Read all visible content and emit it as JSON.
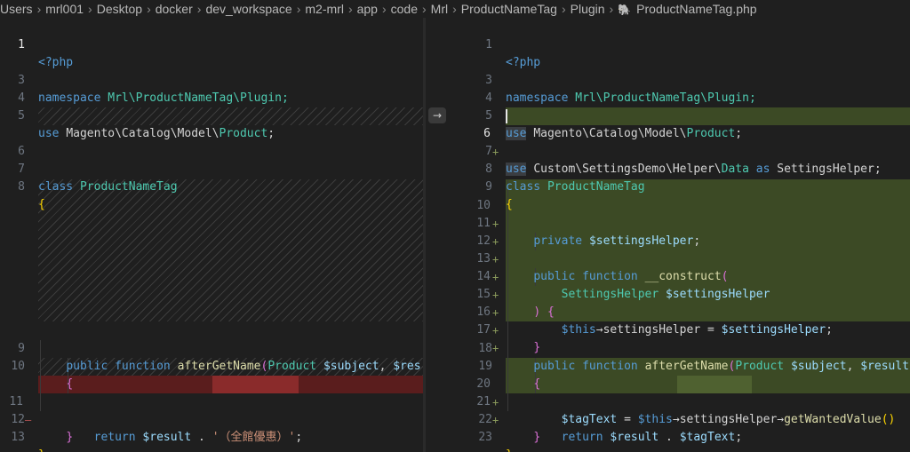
{
  "breadcrumb": {
    "segments": [
      "Users",
      "mrl001",
      "Desktop",
      "docker",
      "dev_workspace",
      "m2-mrl",
      "app",
      "code",
      "Mrl",
      "ProductNameTag",
      "Plugin"
    ],
    "file": "ProductNameTag.php"
  },
  "left": {
    "ln": [
      "1",
      "3",
      "4",
      "5",
      "6",
      "7",
      "8",
      "9",
      "10",
      "11",
      "12",
      "13"
    ],
    "php_open": "<?php",
    "namespace_kw": "namespace",
    "namespace_val": "Mrl\\ProductNameTag\\Plugin;",
    "use_kw": "use",
    "use_path": "Magento\\Catalog\\Model\\",
    "use_cls": "Product",
    "semicolon": ";",
    "class_kw": "class",
    "class_name": "ProductNameTag",
    "brace_open": "{",
    "brace_close": "}",
    "public_kw": "public",
    "function_kw": "function",
    "method": "afterGetName",
    "paren_open": "(",
    "param_type": "Product",
    "param1": "$subject",
    "comma": ",",
    "param2_trunc": "$res",
    "return_kw": "return",
    "result_var": "$result",
    "dot": ".",
    "string": "'（全館優惠）'",
    "deleted_marker": "—"
  },
  "right": {
    "ln": [
      "1",
      "3",
      "4",
      "5",
      "6",
      "7",
      "8",
      "9",
      "10",
      "11",
      "12",
      "13",
      "14",
      "15",
      "16",
      "17",
      "18",
      "19",
      "20",
      "21",
      "22",
      "23"
    ],
    "php_open": "<?php",
    "namespace_kw": "namespace",
    "namespace_val": "Mrl\\ProductNameTag\\Plugin;",
    "use_kw": "use",
    "use_path": "Magento\\Catalog\\Model\\",
    "use_cls": "Product",
    "use2_path": "Custom\\SettingsDemo\\Helper\\",
    "use2_cls": "Data",
    "as_kw": "as",
    "use2_alias": "SettingsHelper",
    "semicolon": ";",
    "class_kw": "class",
    "class_name": "ProductNameTag",
    "brace_open": "{",
    "brace_close": "}",
    "private_kw": "private",
    "prop": "$settingsHelper",
    "public_kw": "public",
    "function_kw": "function",
    "construct": "__construct",
    "paren_open": "(",
    "paren_close_brace": ") {",
    "ctor_type": "SettingsHelper",
    "ctor_param": "$settingsHelper",
    "this": "$this",
    "arrow": "→",
    "assign_prop": "settingsHelper",
    "eq": "=",
    "method": "afterGetName",
    "param_type": "Product",
    "param1": "$subject",
    "comma": ",",
    "param2_trunc": "$result",
    "tag_var": "$tagText",
    "getter": "getWantedValue",
    "getter_call": "()",
    "return_kw": "return",
    "result_var": "$result",
    "dot": ".",
    "added_marker": "+"
  },
  "arrow_button": "→"
}
